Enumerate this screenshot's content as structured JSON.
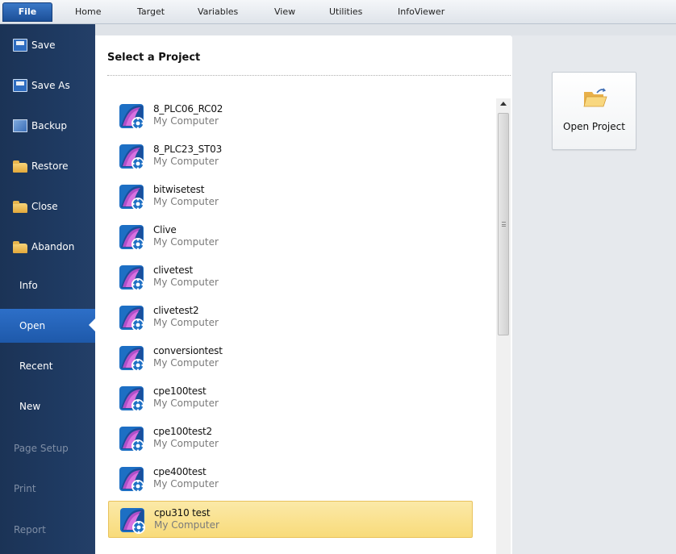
{
  "ribbon": {
    "tabs": [
      "File",
      "Home",
      "Target",
      "Variables",
      "View",
      "Utilities",
      "InfoViewer"
    ]
  },
  "backstage": {
    "items": [
      {
        "label": "Save",
        "icon": "save-icon",
        "enabled": true
      },
      {
        "label": "Save As",
        "icon": "save-icon",
        "enabled": true
      },
      {
        "label": "Backup",
        "icon": "backup-icon",
        "enabled": true
      },
      {
        "label": "Restore",
        "icon": "folder-open-icon",
        "enabled": true
      },
      {
        "label": "Close",
        "icon": "folder-icon",
        "enabled": true
      },
      {
        "label": "Abandon",
        "icon": "folder-icon",
        "enabled": true
      },
      {
        "label": "Info",
        "enabled": true
      },
      {
        "label": "Open",
        "enabled": true,
        "selected": true
      },
      {
        "label": "Recent",
        "enabled": true
      },
      {
        "label": "New",
        "enabled": true
      },
      {
        "label": "Page Setup",
        "enabled": false
      },
      {
        "label": "Print",
        "enabled": false
      },
      {
        "label": "Report",
        "enabled": false
      }
    ]
  },
  "panel": {
    "title": "Select a Project",
    "projects": [
      {
        "name": "8_PLC06_RC02",
        "location": "My Computer"
      },
      {
        "name": "8_PLC23_ST03",
        "location": "My Computer"
      },
      {
        "name": "bitwisetest",
        "location": "My Computer"
      },
      {
        "name": "Clive",
        "location": "My Computer"
      },
      {
        "name": "clivetest",
        "location": "My Computer"
      },
      {
        "name": "clivetest2",
        "location": "My Computer"
      },
      {
        "name": "conversiontest",
        "location": "My Computer"
      },
      {
        "name": "cpe100test",
        "location": "My Computer"
      },
      {
        "name": "cpe100test2",
        "location": "My Computer"
      },
      {
        "name": "cpe400test",
        "location": "My Computer"
      },
      {
        "name": "cpu310 test",
        "location": "My Computer",
        "selected": true
      }
    ]
  },
  "actions": {
    "open_project_label": "Open Project"
  },
  "colors": {
    "backstage_bg": "#1f3b63",
    "selected_nav": "#2d6fc8",
    "selected_item": "#f8db7a"
  }
}
